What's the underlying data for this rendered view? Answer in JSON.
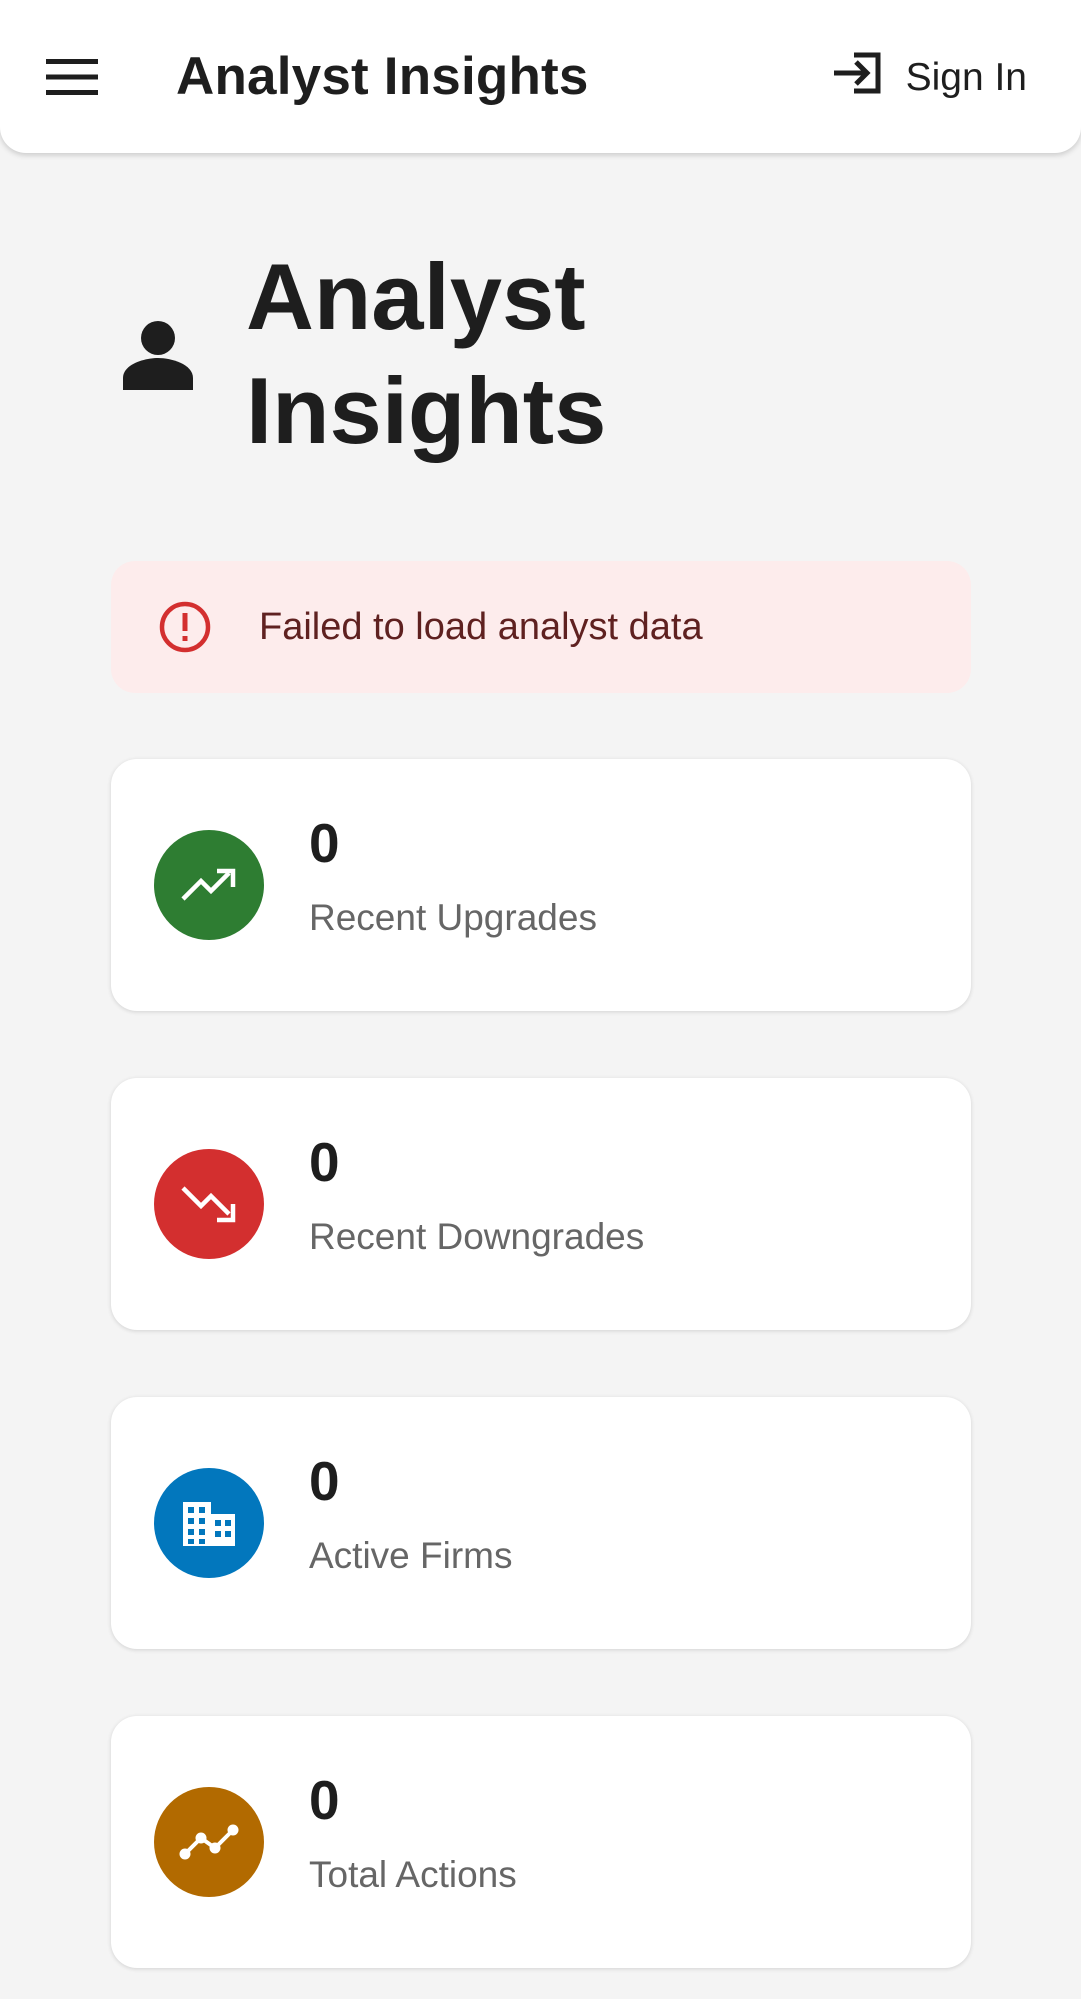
{
  "appbar": {
    "title": "Analyst Insights",
    "menu_icon": "menu-icon",
    "signin_label": "Sign In",
    "signin_icon": "login-icon"
  },
  "page": {
    "title": "Analyst Insights",
    "icon": "person-icon"
  },
  "error": {
    "message": "Failed to load analyst data",
    "icon": "error-outline-icon",
    "background": "#fdecec",
    "icon_color": "#d32f2f"
  },
  "stats": [
    {
      "value": "0",
      "label": "Recent Upgrades",
      "icon": "trending-up-icon",
      "color": "#2e7d32"
    },
    {
      "value": "0",
      "label": "Recent Downgrades",
      "icon": "trending-down-icon",
      "color": "#d32f2f"
    },
    {
      "value": "0",
      "label": "Active Firms",
      "icon": "business-icon",
      "color": "#0277bd"
    },
    {
      "value": "0",
      "label": "Total Actions",
      "icon": "timeline-icon",
      "color": "#b26a00"
    }
  ]
}
